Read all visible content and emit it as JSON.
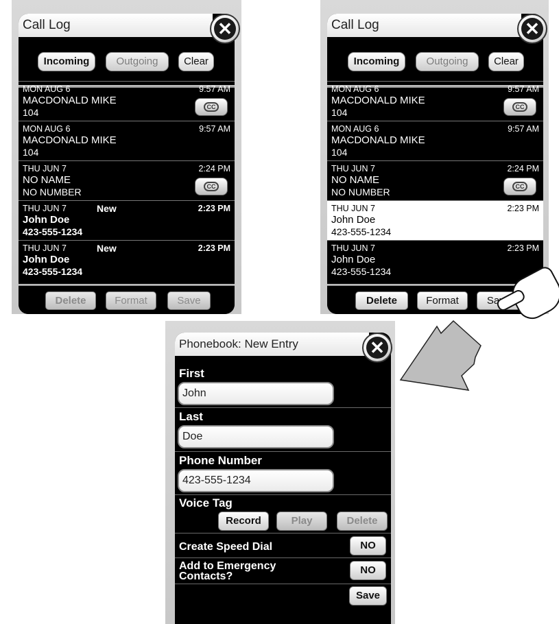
{
  "call_log": {
    "title": "Call Log",
    "tabs": {
      "incoming": "Incoming",
      "outgoing": "Outgoing",
      "clear": "Clear"
    },
    "entries": [
      {
        "date": "MON AUG 6",
        "name": "MACDONALD MIKE",
        "number": "104",
        "time": "9:57 AM",
        "icon": "cc-phone-icon"
      },
      {
        "date": "MON AUG 6",
        "name": "MACDONALD MIKE",
        "number": "104",
        "time": "9:57 AM"
      },
      {
        "date": "THU JUN 7",
        "name": "NO NAME",
        "number": "NO NUMBER",
        "time": "2:24 PM",
        "icon": "cc-phone-icon"
      },
      {
        "date": "THU JUN 7",
        "badge": "New",
        "name": "John Doe",
        "number": "423-555-1234",
        "time": "2:23 PM"
      },
      {
        "date": "THU JUN 7",
        "badge": "New",
        "name": "John Doe",
        "number": "423-555-1234",
        "time": "2:23 PM"
      }
    ],
    "buttons": {
      "delete": "Delete",
      "format": "Format",
      "save": "Save"
    },
    "icons": {
      "close": "close-icon",
      "cc": "CC"
    }
  },
  "phonebook": {
    "title": "Phonebook: New Entry",
    "fields": {
      "first_label": "First",
      "first_value": "John",
      "last_label": "Last",
      "last_value": "Doe",
      "phone_label": "Phone Number",
      "phone_value": "423-555-1234"
    },
    "voice_tag": {
      "label": "Voice Tag",
      "record": "Record",
      "play": "Play",
      "delete": "Delete"
    },
    "speed_dial": {
      "label": "Create Speed Dial",
      "value": "NO"
    },
    "emergency": {
      "label_line1": "Add to Emergency",
      "label_line2": "Contacts?",
      "value": "NO"
    },
    "save": "Save"
  },
  "colors": {
    "screen": "#000000",
    "frame": "#cccccc",
    "selected_row": "#ffffff"
  }
}
